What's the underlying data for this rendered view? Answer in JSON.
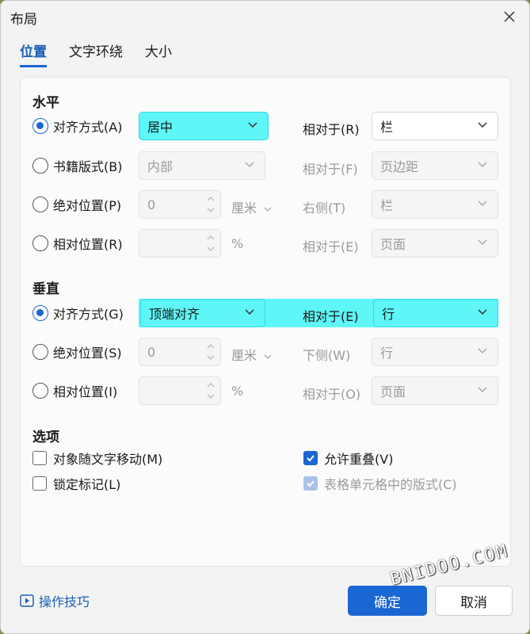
{
  "dialog": {
    "title": "布局"
  },
  "tabs": [
    {
      "label": "位置",
      "active": true
    },
    {
      "label": "文字环绕",
      "active": false
    },
    {
      "label": "大小",
      "active": false
    }
  ],
  "horizontal": {
    "title": "水平",
    "align": {
      "label": "对齐方式(A)",
      "value": "居中",
      "relative_label": "相对于(R)",
      "relative_value": "栏"
    },
    "book": {
      "label": "书籍版式(B)",
      "value": "内部",
      "relative_label": "相对于(F)",
      "relative_value": "页边距"
    },
    "absolute": {
      "label": "绝对位置(P)",
      "value": "0",
      "unit": "厘米",
      "relative_label": "右侧(T)",
      "relative_value": "栏"
    },
    "relative": {
      "label": "相对位置(R)",
      "value": "",
      "unit": "%",
      "relative_label": "相对于(E)",
      "relative_value": "页面"
    }
  },
  "vertical": {
    "title": "垂直",
    "align": {
      "label": "对齐方式(G)",
      "value": "顶端对齐",
      "relative_label": "相对于(E)",
      "relative_value": "行"
    },
    "absolute": {
      "label": "绝对位置(S)",
      "value": "0",
      "unit": "厘米",
      "relative_label": "下侧(W)",
      "relative_value": "行"
    },
    "relative": {
      "label": "相对位置(I)",
      "value": "",
      "unit": "%",
      "relative_label": "相对于(O)",
      "relative_value": "页面"
    }
  },
  "options": {
    "title": "选项",
    "move_with_text": {
      "label": "对象随文字移动(M)",
      "checked": false
    },
    "allow_overlap": {
      "label": "允许重叠(V)",
      "checked": true
    },
    "lock_anchor": {
      "label": "锁定标记(L)",
      "checked": false
    },
    "layout_in_cell": {
      "label": "表格单元格中的版式(C)",
      "checked": true
    }
  },
  "footer": {
    "tips": "操作技巧",
    "ok": "确定",
    "cancel": "取消"
  },
  "watermark": "BNIDOO.COM",
  "colors": {
    "accent": "#1a66d2",
    "highlight": "#5ef6f6"
  }
}
